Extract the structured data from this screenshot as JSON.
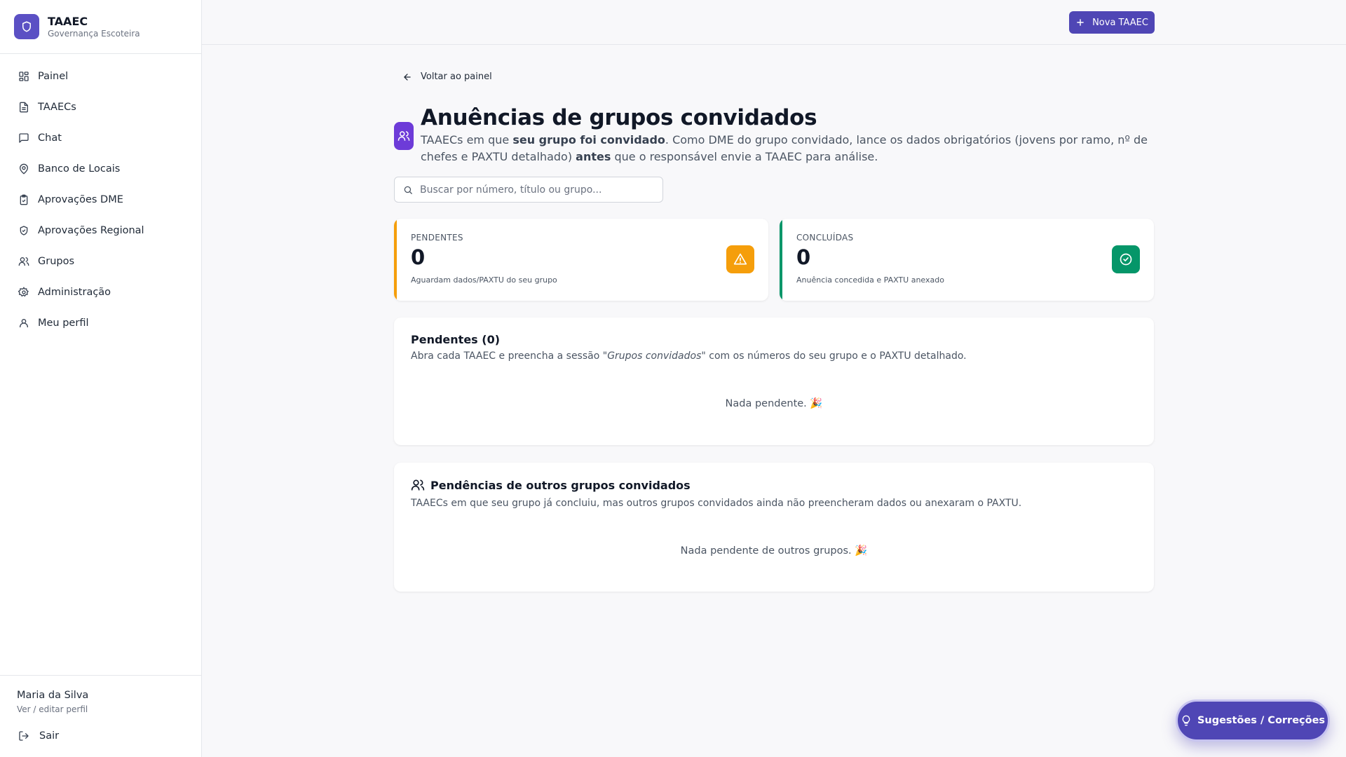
{
  "app": {
    "title": "TAAEC",
    "subtitle": "Governança Escoteira"
  },
  "sidebar": {
    "items": [
      {
        "label": "Painel",
        "icon": "grid-icon"
      },
      {
        "label": "TAAECs",
        "icon": "document-icon"
      },
      {
        "label": "Chat",
        "icon": "chat-icon"
      },
      {
        "label": "Banco de Locais",
        "icon": "map-pin-icon"
      },
      {
        "label": "Aprovações DME",
        "icon": "clipboard-check-icon"
      },
      {
        "label": "Aprovações Regional",
        "icon": "shield-check-icon"
      },
      {
        "label": "Grupos",
        "icon": "users-icon"
      },
      {
        "label": "Administração",
        "icon": "gear-icon"
      },
      {
        "label": "Meu perfil",
        "icon": "user-icon"
      }
    ],
    "user": {
      "name": "Maria da Silva",
      "edit_label": "Ver / editar perfil"
    },
    "logout_label": "Sair"
  },
  "header": {
    "new_button_label": "Nova TAAEC"
  },
  "main": {
    "back_label": "Voltar ao painel",
    "title": "Anuências de grupos convidados",
    "description": {
      "p1": "TAAECs em que ",
      "b1": "seu grupo foi convidado",
      "p2": ". Como DME do grupo convidado, lance os dados obrigatórios (jovens por ramo, nº de chefes e PAXTU detalhado) ",
      "b2": "antes",
      "p3": " que o responsável envie a TAAEC para análise."
    },
    "search": {
      "placeholder": "Buscar por número, título ou grupo...",
      "value": ""
    },
    "stats": {
      "pending": {
        "caption": "PENDENTES",
        "value": "0",
        "note": "Aguardam dados/PAXTU do seu grupo",
        "color": "#f59e0b"
      },
      "done": {
        "caption": "CONCLUÍDAS",
        "value": "0",
        "note": "Anuência concedida e PAXTU anexado",
        "color": "#059669"
      }
    },
    "pending_card": {
      "title": "Pendentes (0)",
      "desc_pre": "Abra cada TAAEC e preencha a sessão ",
      "desc_em": "\"Grupos convidados\"",
      "desc_post": " com os números do seu grupo e o PAXTU detalhado.",
      "empty": "Nada pendente. 🎉"
    },
    "others_card": {
      "title": "Pendências de outros grupos convidados",
      "desc": "TAAECs em que seu grupo já concluiu, mas outros grupos convidados ainda não preencheram dados ou anexaram o PAXTU.",
      "empty": "Nada pendente de outros grupos. 🎉"
    }
  },
  "fab": {
    "label": "Sugestões / Correções"
  },
  "colors": {
    "brand": "#4f46b5",
    "accent_purple": "#6d3bd8",
    "warning": "#f59e0b",
    "success": "#059669"
  }
}
